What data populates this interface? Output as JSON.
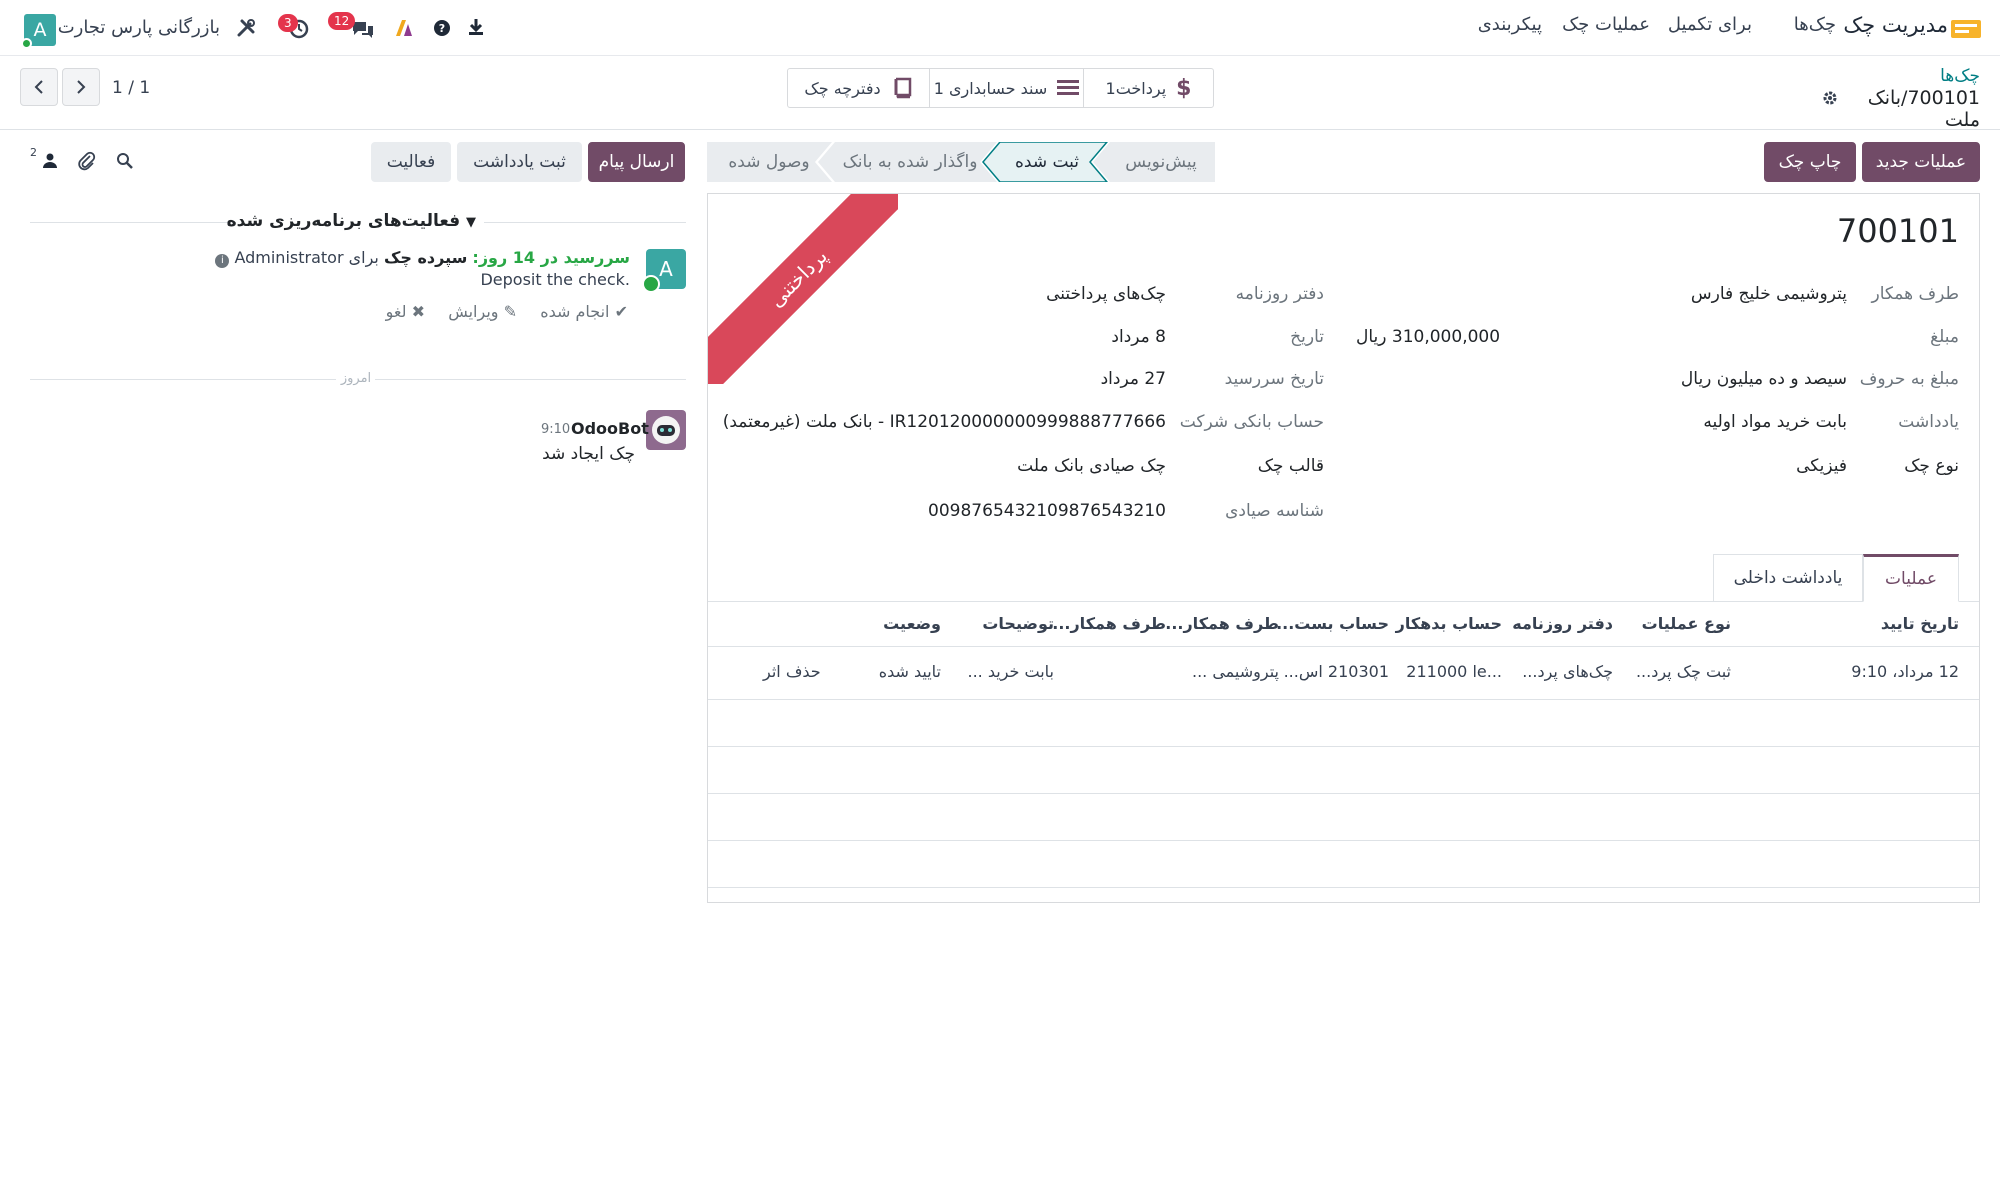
{
  "navbar": {
    "app_name": "مدیریت چک",
    "menu": [
      "چک‌ها",
      "برای تکمیل",
      "عملیات چک",
      "پیکربندی"
    ],
    "company": "بازرگانی پارس تجارت",
    "avatar_letter": "A",
    "activity_count": "3",
    "message_count": "12"
  },
  "breadcrumb": {
    "parent": "چک‌ها",
    "current": "700101/بانک ملت"
  },
  "smart_buttons": {
    "payment": "1پرداخت",
    "accounting_doc": "1 سند حسابداری",
    "checkbook": "دفترچه چک"
  },
  "pager": {
    "value": "1 / 1"
  },
  "actions": {
    "new_operation": "عملیات جدید",
    "print_check": "چاپ چک"
  },
  "statusbar": [
    "پیش‌نویس",
    "ثبت شده",
    "واگذار شده به بانک",
    "وصول شده"
  ],
  "chatter_buttons": {
    "send_message": "ارسال پیام",
    "log_note": "ثبت یادداشت",
    "activity": "فعالیت",
    "followers_count": "2"
  },
  "record": {
    "ribbon": "پرداختنی",
    "title": "700101",
    "fields_right": [
      {
        "label": "طرف همکار",
        "value": "پتروشیمی خلیج فارس"
      },
      {
        "label": "مبلغ",
        "value": "310,000,000 ریال"
      },
      {
        "label": "مبلغ به حروف",
        "value": "سیصد و ده میلیون ریال"
      },
      {
        "label": "یادداشت",
        "value": "بابت خرید مواد اولیه"
      },
      {
        "label": "نوع چک",
        "value": "فیزیکی"
      }
    ],
    "fields_left": [
      {
        "label": "دفتر روزنامه",
        "value": "چک‌های پرداختنی"
      },
      {
        "label": "تاریخ",
        "value": "8 مرداد"
      },
      {
        "label": "تاریخ سررسید",
        "value": "27 مرداد"
      },
      {
        "label": "حساب بانکی شرکت",
        "value": "IR120120000000999888777666 - بانک ملت (غیرمعتمد)"
      },
      {
        "label": "قالب چک",
        "value": "چک صیادی بانک ملت"
      },
      {
        "label": "شناسه صیادی",
        "value": "0098765432109876543210"
      }
    ],
    "tabs": [
      "عملیات",
      "یادداشت داخلی"
    ]
  },
  "operations_table": {
    "headers": [
      "تاریخ تایید",
      "نوع عملیات",
      "دفتر روزنامه",
      "حساب بدهکار",
      "حساب بست...",
      "طرف همکار...",
      "طرف همکار...",
      "توضیحات",
      "وضعیت"
    ],
    "rows": [
      [
        "12 مرداد، 9:10",
        "ثبت چک پرد...",
        "چک‌های پرد...",
        "211000 le...",
        "210301 اس...",
        "پتروشیمی ...",
        "",
        "بابت خرید ...",
        "تایید شده"
      ]
    ],
    "delete_label": "حذف اثر"
  },
  "chatter": {
    "planned_activities": "فعالیت‌های برنامه‌ریزی شده",
    "activity": {
      "due": "سررسید در 14 روز:",
      "title": "سپرده چک",
      "for": "برای Administrator",
      "note": "Deposit the check.",
      "done": "انجام شده",
      "edit": "ویرایش",
      "cancel": "لغو",
      "avatar_letter": "A"
    },
    "today": "امروز",
    "message": {
      "author": "OdooBot",
      "time": "9:10",
      "body": "چک ایجاد شد"
    }
  },
  "colors": {
    "primary": "#714b67",
    "teal": "#017e84",
    "ribbon": "#d9485a",
    "badge": "#e4344c",
    "activity_green": "#28a745"
  }
}
